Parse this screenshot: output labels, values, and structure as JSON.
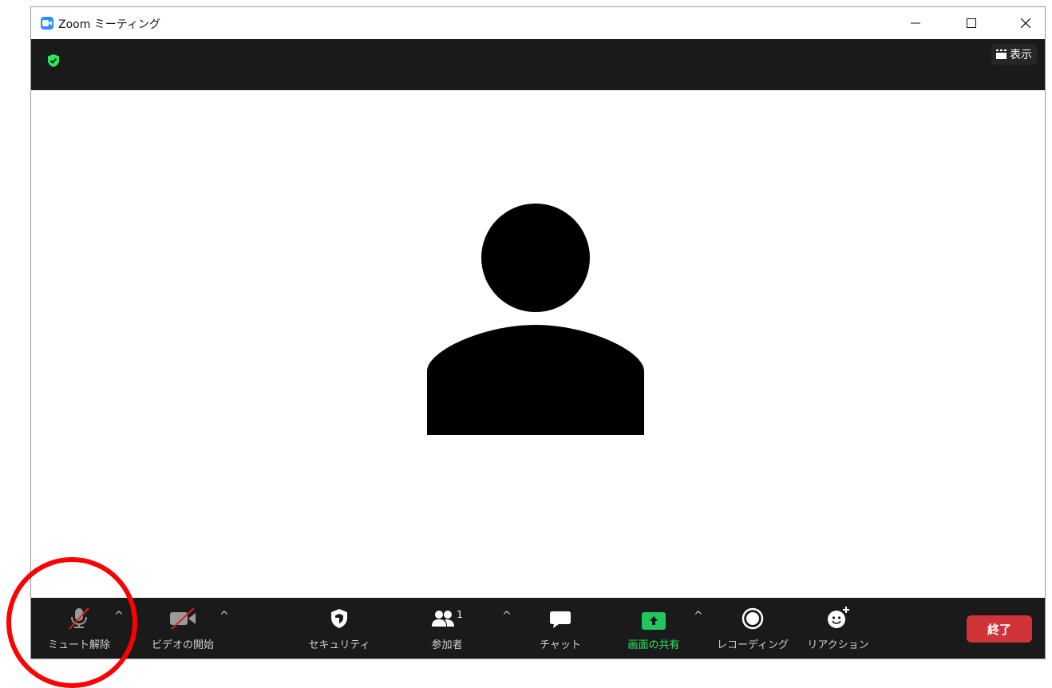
{
  "window": {
    "title": "Zoom ミーティング",
    "controls": {
      "minimize": "minimize",
      "maximize": "maximize",
      "close": "close"
    }
  },
  "topbar": {
    "view_label": "表示",
    "icons": {
      "security_status": "shield-check-icon",
      "view": "grid-icon"
    }
  },
  "video": {
    "avatar_icon": "person-silhouette-icon"
  },
  "toolbar": {
    "unmute": {
      "label": "ミュート解除",
      "icon": "mic-muted-icon"
    },
    "start_video": {
      "label": "ビデオの開始",
      "icon": "video-off-icon"
    },
    "security": {
      "label": "セキュリティ",
      "icon": "shield-icon"
    },
    "participants": {
      "label": "参加者",
      "icon": "participants-icon",
      "count": "1"
    },
    "chat": {
      "label": "チャット",
      "icon": "chat-bubble-icon"
    },
    "share_screen": {
      "label": "画面の共有",
      "icon": "share-screen-icon"
    },
    "recording": {
      "label": "レコーディング",
      "icon": "record-icon"
    },
    "reactions": {
      "label": "リアクション",
      "icon": "reaction-icon"
    },
    "end": {
      "label": "終了"
    }
  },
  "colors": {
    "accent_blue": "#2d8cff",
    "share_green": "#22c55e",
    "security_green": "#2ee85e",
    "end_red": "#d13438",
    "annotation_red": "#ff0000",
    "toolbar_bg": "#1a1a1a"
  }
}
